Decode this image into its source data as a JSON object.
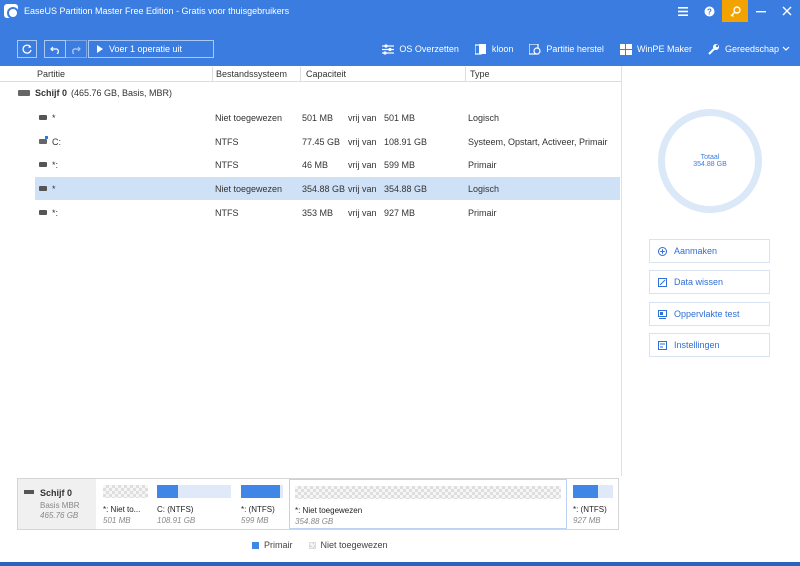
{
  "window": {
    "title": "EaseUS Partition Master Free Edition - Gratis voor thuisgebruikers",
    "buttons": [
      "menu-icon",
      "help-icon",
      "key-icon",
      "minimize-icon",
      "close-icon"
    ]
  },
  "toolbar": {
    "execute_label": "Voer 1 operatie uit",
    "items": [
      {
        "name": "os-overzetten",
        "label": "OS Overzetten",
        "icon": "os-transfer-icon"
      },
      {
        "name": "kloon",
        "label": "kloon",
        "icon": "clone-icon"
      },
      {
        "name": "partitie-herstel",
        "label": "Partitie herstel",
        "icon": "partition-recovery-icon"
      },
      {
        "name": "winpe-maker",
        "label": "WinPE Maker",
        "icon": "windows-icon"
      },
      {
        "name": "gereedschap",
        "label": "Gereedschap",
        "icon": "tools-icon"
      }
    ]
  },
  "table": {
    "headers": {
      "partition": "Partitie",
      "filesystem": "Bestandssysteem",
      "capacity": "Capaciteit",
      "type": "Type"
    },
    "disk": {
      "name": "Schijf 0",
      "info": "(465.76 GB, Basis, MBR)"
    },
    "rows": [
      {
        "name": "*",
        "fs": "Niet toegewezen",
        "used": "501 MB",
        "of": "vrij van",
        "total": "501 MB",
        "type": "Logisch"
      },
      {
        "name": "C:",
        "fs": "NTFS",
        "used": "77.45 GB",
        "of": "vrij van",
        "total": "108.91 GB",
        "type": "Systeem, Opstart, Activeer, Primair"
      },
      {
        "name": "*:",
        "fs": "NTFS",
        "used": "46 MB",
        "of": "vrij van",
        "total": "599 MB",
        "type": "Primair"
      },
      {
        "name": "*",
        "fs": "Niet toegewezen",
        "used": "354.88 GB",
        "of": "vrij van",
        "total": "354.88 GB",
        "type": "Logisch"
      },
      {
        "name": "*:",
        "fs": "NTFS",
        "used": "353 MB",
        "of": "vrij van",
        "total": "927 MB",
        "type": "Primair"
      }
    ],
    "selected_row": 3
  },
  "side": {
    "total_label": "Totaal",
    "total_value": "354.88 GB",
    "actions": [
      {
        "name": "aanmaken",
        "label": "Aanmaken",
        "icon": "plus-circle-icon"
      },
      {
        "name": "data-wissen",
        "label": "Data wissen",
        "icon": "erase-icon"
      },
      {
        "name": "oppervlakte-test",
        "label": "Oppervlakte test",
        "icon": "surface-test-icon"
      },
      {
        "name": "instellingen",
        "label": "Instellingen",
        "icon": "settings-icon"
      }
    ]
  },
  "diskmap": {
    "disk": {
      "name": "Schijf 0",
      "type": "Basis MBR",
      "size": "465.76 GB"
    },
    "parts": [
      {
        "label": "*: Niet to...",
        "size": "501 MB",
        "kind": "free",
        "fill": 0
      },
      {
        "label": "C: (NTFS)",
        "size": "108.91 GB",
        "kind": "used",
        "fill": 0.29
      },
      {
        "label": "*: (NTFS)",
        "size": "599 MB",
        "kind": "used",
        "fill": 0.92
      },
      {
        "label": "*: Niet toegewezen",
        "size": "354.88 GB",
        "kind": "free",
        "fill": 0
      },
      {
        "label": "*: (NTFS)",
        "size": "927 MB",
        "kind": "used",
        "fill": 0.62
      }
    ]
  },
  "legend": {
    "primary": "Primair",
    "unallocated": "Niet toegewezen"
  }
}
